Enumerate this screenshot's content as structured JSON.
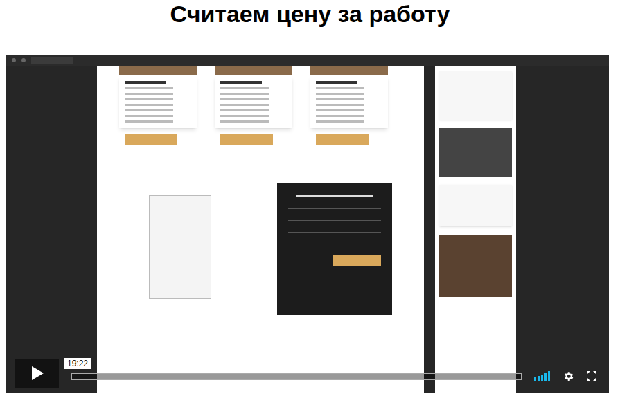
{
  "page": {
    "title": "Считаем цену за работу"
  },
  "player": {
    "playing": false,
    "tooltip": "19:22",
    "progress": {
      "level": 0.0
    },
    "volume": {
      "level": 1.0,
      "bars": 5
    }
  }
}
